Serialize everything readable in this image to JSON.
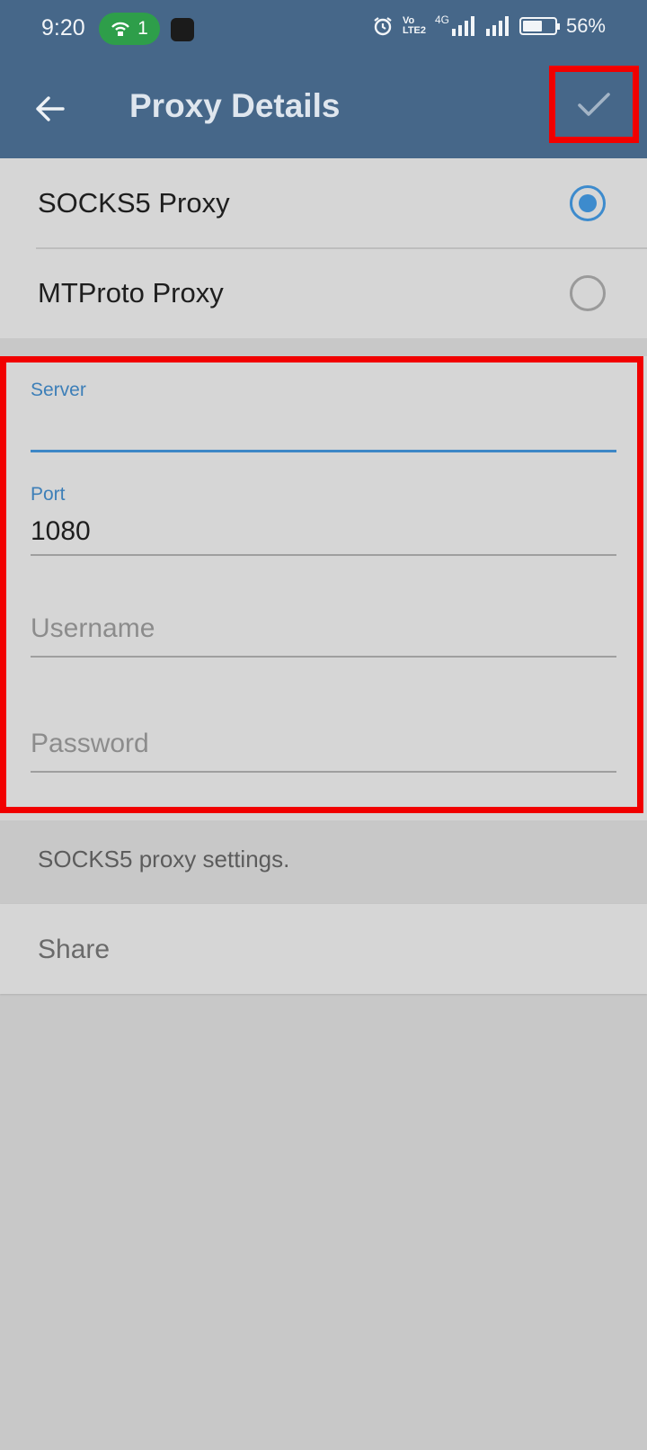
{
  "status_bar": {
    "time": "9:20",
    "hotspot_count": "1",
    "network_vo_lte": "Vo LTE2",
    "network_type": "4G",
    "battery": "56%",
    "battery_level": 0.56
  },
  "app_bar": {
    "title": "Proxy Details",
    "back_icon": "arrow-left-icon",
    "done_icon": "check-icon"
  },
  "proxy_types": [
    {
      "label": "SOCKS5 Proxy",
      "selected": true
    },
    {
      "label": "MTProto Proxy",
      "selected": false
    }
  ],
  "fields": {
    "server": {
      "label": "Server",
      "value": ""
    },
    "port": {
      "label": "Port",
      "value": "1080"
    },
    "username": {
      "placeholder": "Username",
      "value": ""
    },
    "password": {
      "placeholder": "Password",
      "value": ""
    }
  },
  "info": {
    "text": "SOCKS5 proxy settings."
  },
  "share": {
    "label": "Share"
  },
  "colors": {
    "app_bar": "#466789",
    "accent": "#3d8bcd",
    "highlight": "#f10000",
    "background": "#c8c8c8"
  }
}
